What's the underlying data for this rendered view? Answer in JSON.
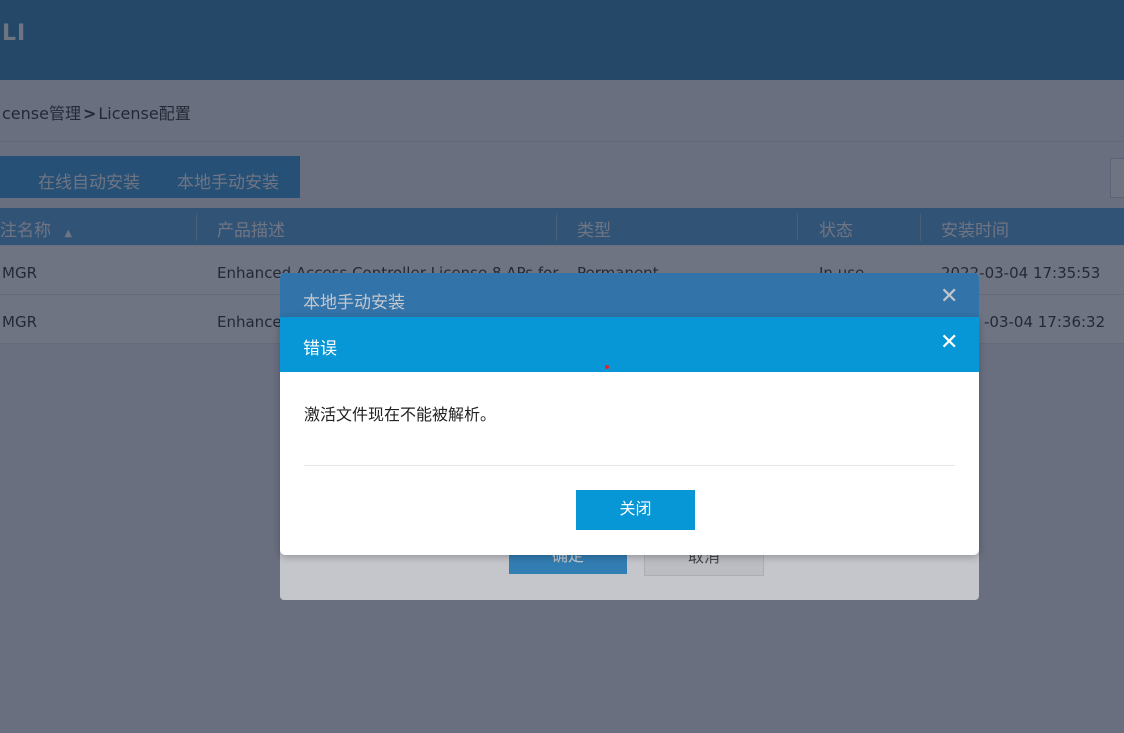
{
  "header": {
    "brand": "LI"
  },
  "breadcrumb": {
    "part1": "cense管理",
    "separator": ">",
    "part2": "License配置"
  },
  "toolbar": {
    "online_install": "在线自动安装",
    "local_install": "本地手动安装"
  },
  "table": {
    "columns": [
      "注名称",
      "产品描述",
      "类型",
      "状态",
      "安装时间"
    ],
    "rows": [
      {
        "name": "MGR",
        "desc": "Enhanced Access Controller License 8 APs for",
        "type": "Permanent",
        "status": "In use",
        "time": "2022-03-04 17:35:53"
      },
      {
        "name": "MGR",
        "desc": "Enhanced",
        "type": "",
        "status": "",
        "time": "-03-04 17:36:32"
      }
    ]
  },
  "dialog_install": {
    "title": "本地手动安装",
    "ok_label": "确定",
    "cancel_label": "取消"
  },
  "dialog_error": {
    "title": "错误",
    "message": "激活文件现在不能被解析。",
    "close_label": "关闭"
  },
  "icons": {
    "close": "close-icon",
    "sort": "sort-asc-icon"
  },
  "colors": {
    "primary": "#0796d6",
    "header": "#3a86b8"
  }
}
